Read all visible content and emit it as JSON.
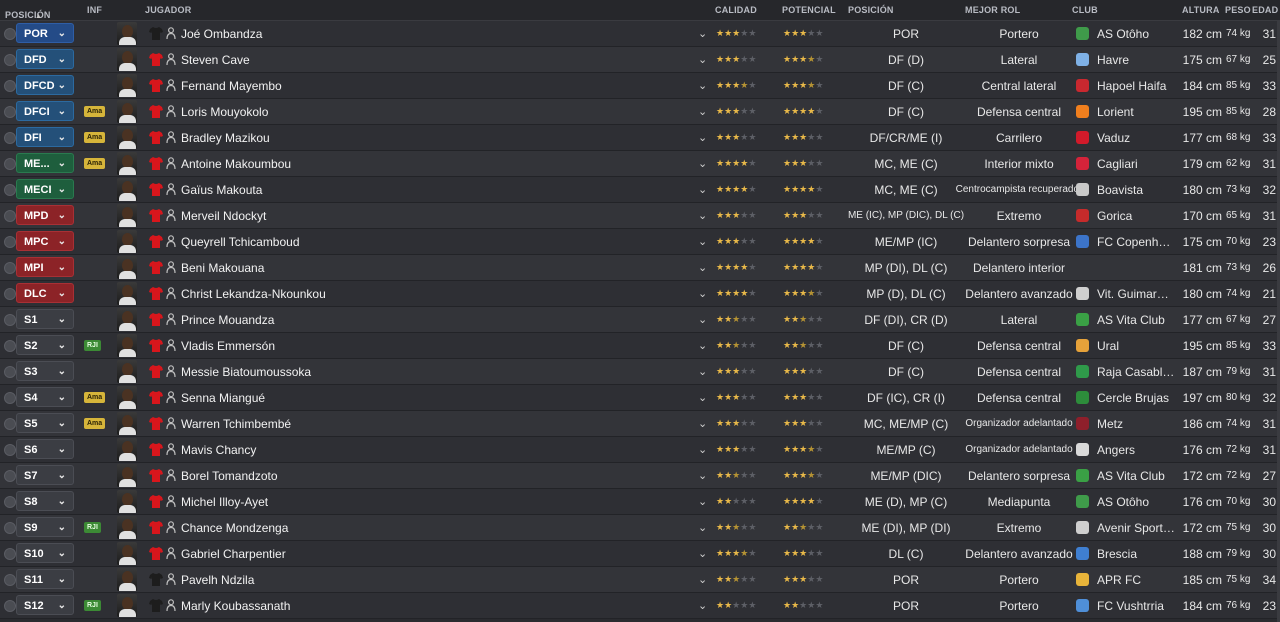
{
  "headers": {
    "posicion": "POSICIÓN",
    "inf": "INF",
    "jugador": "JUGADOR",
    "calidad": "CALIDAD",
    "potencial": "POTENCIAL",
    "posicion2": "POSICIÓN",
    "mejor_rol": "MEJOR ROL",
    "club": "CLUB",
    "altura": "ALTURA",
    "peso": "PESO",
    "edad": "EDAD",
    "sort_icon": "▲"
  },
  "colors": {
    "goalkeeper": "#244b87",
    "defender": "#245079",
    "midfielder": "#1e5e3d",
    "forward": "#8c2327",
    "substitute": "#3b3d43",
    "star": "#e9b949",
    "shirt_outfield": "#d8161c",
    "shirt_goalkeeper": "#1d1d1d"
  },
  "players": [
    {
      "slot": "POR",
      "slot_type": "gk",
      "inf": "",
      "name": "Joé Ombandza",
      "shirt": "gk",
      "cal": 3,
      "pot": 3,
      "pos": "POR",
      "role": "Portero",
      "club": "AS Otôho",
      "crest": "#3f9b4a",
      "height": "182 cm",
      "weight": "74 kg",
      "age": "31"
    },
    {
      "slot": "DFD",
      "slot_type": "df",
      "inf": "",
      "name": "Steven Cave",
      "shirt": "out",
      "cal": 3,
      "pot": 3.5,
      "pos": "DF (D)",
      "role": "Lateral",
      "club": "Havre",
      "crest": "#7fb1e6",
      "height": "175 cm",
      "weight": "67 kg",
      "age": "25"
    },
    {
      "slot": "DFCD",
      "slot_type": "df",
      "inf": "",
      "name": "Fernand Mayembo",
      "shirt": "out",
      "cal": 3.5,
      "pot": 3.5,
      "pos": "DF (C)",
      "role": "Central lateral",
      "club": "Hapoel Haifa",
      "crest": "#c9282f",
      "height": "184 cm",
      "weight": "85 kg",
      "age": "33"
    },
    {
      "slot": "DFCI",
      "slot_type": "df",
      "inf": "Ama",
      "name": "Loris Mouyokolo",
      "shirt": "out",
      "cal": 3,
      "pot": 4,
      "pos": "DF (C)",
      "role": "Defensa central",
      "club": "Lorient",
      "crest": "#f07f1e",
      "height": "195 cm",
      "weight": "85 kg",
      "age": "28"
    },
    {
      "slot": "DFI",
      "slot_type": "df",
      "inf": "Ama",
      "name": "Bradley Mazikou",
      "shirt": "out",
      "cal": 3,
      "pot": 3,
      "pos": "DF/CR/ME (I)",
      "role": "Carrilero",
      "club": "Vaduz",
      "crest": "#d11a2a",
      "height": "177 cm",
      "weight": "68 kg",
      "age": "33"
    },
    {
      "slot": "ME...",
      "slot_type": "mf",
      "inf": "Ama",
      "name": "Antoine Makoumbou",
      "shirt": "out",
      "cal": 4,
      "pot": 3,
      "pos": "MC, ME (C)",
      "role": "Interior mixto",
      "club": "Cagliari",
      "crest": "#d4233a",
      "height": "179 cm",
      "weight": "62 kg",
      "age": "31"
    },
    {
      "slot": "MECI",
      "slot_type": "mf",
      "inf": "",
      "name": "Gaïus Makouta",
      "shirt": "out",
      "cal": 4,
      "pot": 4,
      "pos": "MC, ME (C)",
      "role": "Centrocampista recuperador",
      "role_small": true,
      "club": "Boavista",
      "crest": "#c9c9c9",
      "height": "180 cm",
      "weight": "73 kg",
      "age": "32"
    },
    {
      "slot": "MPD",
      "slot_type": "fw",
      "inf": "",
      "name": "Merveil Ndockyt",
      "shirt": "out",
      "cal": 3,
      "pot": 3,
      "pos": "ME (IC), MP (DIC), DL (C)",
      "pos_small": true,
      "role": "Extremo",
      "club": "Gorica",
      "crest": "#c62b2b",
      "height": "170 cm",
      "weight": "65 kg",
      "age": "31"
    },
    {
      "slot": "MPC",
      "slot_type": "fw",
      "inf": "",
      "name": "Queyrell Tchicamboud",
      "shirt": "out",
      "cal": 3,
      "pot": 4,
      "pos": "ME/MP (IC)",
      "role": "Delantero sorpresa",
      "club": "FC Copenhag...",
      "crest": "#3c74c9",
      "height": "175 cm",
      "weight": "70 kg",
      "age": "23"
    },
    {
      "slot": "MPI",
      "slot_type": "fw",
      "inf": "",
      "name": "Beni Makouana",
      "shirt": "out",
      "cal": 4,
      "pot": 4,
      "pos": "MP (DI), DL (C)",
      "role": "Delantero interior",
      "club": "",
      "crest": "",
      "height": "181 cm",
      "weight": "73 kg",
      "age": "26"
    },
    {
      "slot": "DLC",
      "slot_type": "fw",
      "inf": "",
      "name": "Christ Lekandza-Nkounkou",
      "shirt": "out",
      "cal": 4,
      "pot": 3.5,
      "pos": "MP (D), DL (C)",
      "role": "Delantero avanzado",
      "club": "Vit. Guimarães",
      "crest": "#cfcfcf",
      "height": "180 cm",
      "weight": "74 kg",
      "age": "21"
    },
    {
      "slot": "S1",
      "slot_type": "sub",
      "inf": "",
      "name": "Prince Mouandza",
      "shirt": "out",
      "cal": 2.5,
      "pot": 2.5,
      "pos": "DF (DI), CR (D)",
      "role": "Lateral",
      "club": "AS Vita Club",
      "crest": "#3aa045",
      "height": "177 cm",
      "weight": "67 kg",
      "age": "27"
    },
    {
      "slot": "S2",
      "slot_type": "sub",
      "inf": "RJI",
      "name": "Vladis Emmersón",
      "shirt": "out",
      "cal": 2.5,
      "pot": 2.5,
      "pos": "DF (C)",
      "role": "Defensa central",
      "club": "Ural",
      "crest": "#e6a23a",
      "height": "195 cm",
      "weight": "85 kg",
      "age": "33"
    },
    {
      "slot": "S3",
      "slot_type": "sub",
      "inf": "",
      "name": "Messie Biatoumoussoka",
      "shirt": "out",
      "cal": 3,
      "pot": 3,
      "pos": "DF (C)",
      "role": "Defensa central",
      "club": "Raja Casabla...",
      "crest": "#2f9a4a",
      "height": "187 cm",
      "weight": "79 kg",
      "age": "31"
    },
    {
      "slot": "S4",
      "slot_type": "sub",
      "inf": "Ama",
      "name": "Senna Miangué",
      "shirt": "out",
      "cal": 3,
      "pot": 3,
      "pos": "DF (IC), CR (I)",
      "role": "Defensa central",
      "club": "Cercle Brujas",
      "crest": "#2d8c3b",
      "height": "197 cm",
      "weight": "80 kg",
      "age": "32"
    },
    {
      "slot": "S5",
      "slot_type": "sub",
      "inf": "Ama",
      "name": "Warren Tchimbembé",
      "shirt": "out",
      "cal": 3,
      "pot": 3,
      "pos": "MC, ME/MP (C)",
      "role": "Organizador adelantado",
      "role_small": true,
      "club": "Metz",
      "crest": "#8e1f2b",
      "height": "186 cm",
      "weight": "74 kg",
      "age": "31"
    },
    {
      "slot": "S6",
      "slot_type": "sub",
      "inf": "",
      "name": "Mavis Chancy",
      "shirt": "out",
      "cal": 3,
      "pot": 3.5,
      "pos": "ME/MP (C)",
      "role": "Organizador adelantado",
      "role_small": true,
      "club": "Angers",
      "crest": "#d9d9d9",
      "height": "176 cm",
      "weight": "72 kg",
      "age": "31"
    },
    {
      "slot": "S7",
      "slot_type": "sub",
      "inf": "",
      "name": "Borel Tomandzoto",
      "shirt": "out",
      "cal": 2.5,
      "pot": 3.5,
      "pos": "ME/MP (DIC)",
      "role": "Delantero sorpresa",
      "club": "AS Vita Club",
      "crest": "#3aa045",
      "height": "172 cm",
      "weight": "72 kg",
      "age": "27"
    },
    {
      "slot": "S8",
      "slot_type": "sub",
      "inf": "",
      "name": "Michel Illoy-Ayet",
      "shirt": "out",
      "cal": 2,
      "pot": 4,
      "pos": "ME (D), MP (C)",
      "role": "Mediapunta",
      "club": "AS Otôho",
      "crest": "#3f9b4a",
      "height": "176 cm",
      "weight": "70 kg",
      "age": "30"
    },
    {
      "slot": "S9",
      "slot_type": "sub",
      "inf": "RJI",
      "name": "Chance Mondzenga",
      "shirt": "out",
      "cal": 2.5,
      "pot": 2.5,
      "pos": "ME (DI), MP (DI)",
      "role": "Extremo",
      "club": "Avenir Sportif...",
      "crest": "#cfcfcf",
      "height": "172 cm",
      "weight": "75 kg",
      "age": "30"
    },
    {
      "slot": "S10",
      "slot_type": "sub",
      "inf": "",
      "name": "Gabriel Charpentier",
      "shirt": "out",
      "cal": 3.5,
      "pot": 3,
      "pos": "DL (C)",
      "role": "Delantero avanzado",
      "club": "Brescia",
      "crest": "#3f7fd1",
      "height": "188 cm",
      "weight": "79 kg",
      "age": "30"
    },
    {
      "slot": "S11",
      "slot_type": "sub",
      "inf": "",
      "name": "Pavelh Ndzila",
      "shirt": "gk",
      "cal": 2.5,
      "pot": 3,
      "pos": "POR",
      "role": "Portero",
      "club": "APR FC",
      "crest": "#e8b43a",
      "height": "185 cm",
      "weight": "75 kg",
      "age": "34"
    },
    {
      "slot": "S12",
      "slot_type": "sub",
      "inf": "RJI",
      "name": "Marly Koubassanath",
      "shirt": "gk",
      "cal": 2,
      "pot": 2,
      "pos": "POR",
      "role": "Portero",
      "club": "FC Vushtrria",
      "crest": "#4f8fd8",
      "height": "184 cm",
      "weight": "76 kg",
      "age": "23"
    }
  ]
}
